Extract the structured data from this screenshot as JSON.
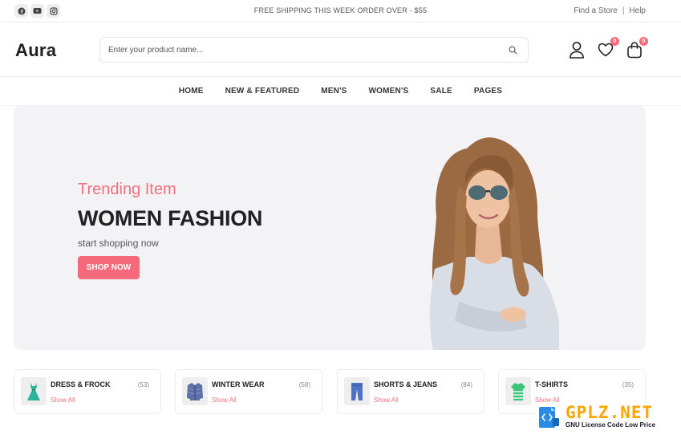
{
  "topbar": {
    "social_icons": [
      "facebook-icon",
      "youtube-icon",
      "instagram-icon"
    ],
    "promo_text": "FREE SHIPPING THIS WEEK ORDER OVER - $55",
    "find_store": "Find a Store",
    "separator": "|",
    "help": "Help"
  },
  "header": {
    "logo": "Aura",
    "search_placeholder": "Enter your product name...",
    "wishlist_count": "0",
    "cart_count": "0"
  },
  "nav": {
    "items": [
      "HOME",
      "NEW & FEATURED",
      "MEN'S",
      "WOMEN'S",
      "SALE",
      "PAGES"
    ]
  },
  "hero": {
    "kicker": "Trending Item",
    "title": "WOMEN FASHION",
    "subtitle": "start shopping now",
    "button": "SHOP NOW"
  },
  "categories": [
    {
      "title": "DRESS & FROCK",
      "count": "(53)",
      "link": "Show All",
      "icon": "dress-icon"
    },
    {
      "title": "WINTER WEAR",
      "count": "(58)",
      "link": "Show All",
      "icon": "coat-icon"
    },
    {
      "title": "SHORTS & JEANS",
      "count": "(84)",
      "link": "Show All",
      "icon": "jeans-icon"
    },
    {
      "title": "T-SHIRTS",
      "count": "(35)",
      "link": "Show All",
      "icon": "tshirt-icon"
    }
  ],
  "watermark": {
    "brand": "GPLZ.NET",
    "tagline": "GNU License Code Low Price"
  },
  "colors": {
    "accent": "#f46a7a",
    "hero_bg": "#f3f3f5",
    "text_dark": "#212121",
    "watermark_orange": "#ffa500"
  }
}
